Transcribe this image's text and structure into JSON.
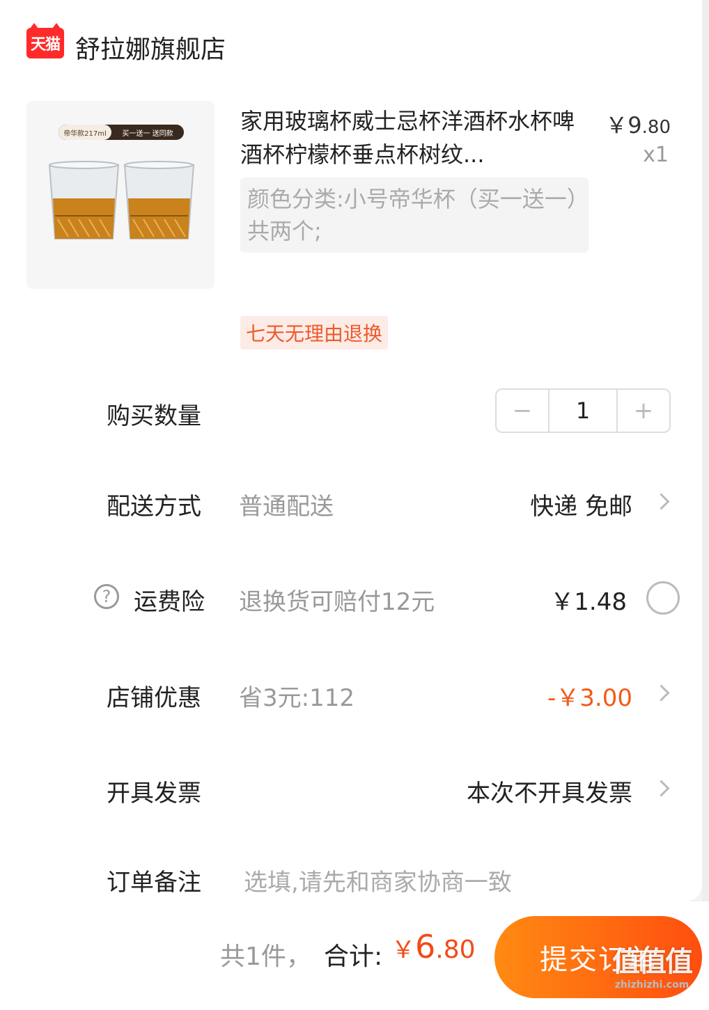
{
  "store": {
    "logo_text": "天猫",
    "name": "舒拉娜旗舰店"
  },
  "product": {
    "image_tag_left": "帝华款217ml",
    "image_tag_right": "买一送一 送同款",
    "title": "家用玻璃杯威士忌杯洋酒杯水杯啤酒杯柠檬杯垂点杯树纹...",
    "price_symbol": "￥",
    "price_int": "9",
    "price_cents": ".80",
    "quantity_label": "x1",
    "variant": "颜色分类:小号帝华杯（买一送一）共两个;",
    "return_badge": "七天无理由退换"
  },
  "rows": {
    "quantity": {
      "label": "购买数量",
      "minus": "−",
      "value": "1",
      "plus": "+"
    },
    "delivery": {
      "label": "配送方式",
      "desc": "普通配送",
      "value": "快递 免邮"
    },
    "insurance": {
      "help": "?",
      "label": "运费险",
      "desc": "退换货可赔付12元",
      "value": "￥1.48"
    },
    "coupon": {
      "label": "店铺优惠",
      "desc": "省3元:112",
      "value": "-￥3.00"
    },
    "invoice": {
      "label": "开具发票",
      "value": "本次不开具发票"
    },
    "note": {
      "label": "订单备注",
      "placeholder": "选填,请先和商家协商一致"
    }
  },
  "footer": {
    "count": "共1件，",
    "total_label": "合计:",
    "total_symbol": "￥",
    "total_int": "6",
    "total_cents": ".80",
    "submit": "提交订单"
  },
  "watermark": {
    "big": "值值值",
    "small": "zhizhizhi.com"
  }
}
